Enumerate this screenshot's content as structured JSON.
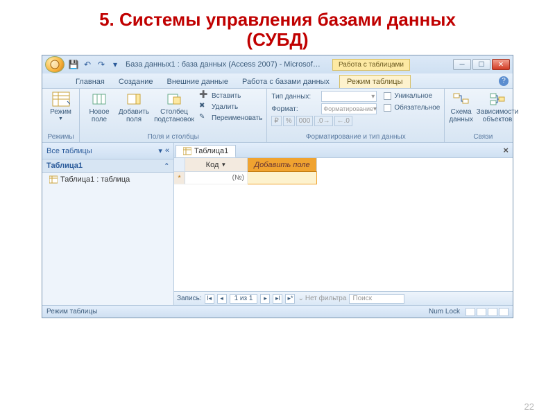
{
  "slide": {
    "title_line1": "5. Системы управления базами данных",
    "title_line2": "(СУБД)",
    "page_number": "22"
  },
  "window": {
    "title": "База данных1 : база данных (Access 2007) - Microsof…",
    "context_group_label": "Работа с таблицами",
    "min": "_",
    "max": "▱",
    "close": "✕"
  },
  "tabs": {
    "home": "Главная",
    "create": "Создание",
    "external": "Внешние данные",
    "dbtools": "Работа с базами данных",
    "datasheet": "Режим таблицы"
  },
  "ribbon": {
    "groups": {
      "views": {
        "label": "Режимы",
        "view_btn": "Режим"
      },
      "fields_cols": {
        "label": "Поля и столбцы",
        "new_field": "Новое поле",
        "add_fields": "Добавить поля",
        "lookup_col": "Столбец подстановок",
        "insert": "Вставить",
        "delete": "Удалить",
        "rename": "Переименовать"
      },
      "fmt": {
        "label": "Форматирование и тип данных",
        "dtype_label": "Тип данных:",
        "fmt_label": "Формат:",
        "fmt_placeholder": "Форматирование",
        "unique": "Уникальное",
        "required": "Обязательное",
        "numfmt": "000"
      },
      "rel": {
        "label": "Связи",
        "schema": "Схема данных",
        "deps": "Зависимости объектов"
      }
    }
  },
  "nav": {
    "header": "Все таблицы",
    "group": "Таблица1",
    "item": "Таблица1 : таблица"
  },
  "doc": {
    "tab": "Таблица1",
    "col_id": "Код",
    "col_add": "Добавить поле",
    "new_id_placeholder": "(№)"
  },
  "recordnav": {
    "label": "Запись:",
    "pos": "1 из 1",
    "nofilter": "Нет фильтра",
    "search": "Поиск"
  },
  "status": {
    "mode": "Режим таблицы",
    "numlock": "Num Lock"
  }
}
